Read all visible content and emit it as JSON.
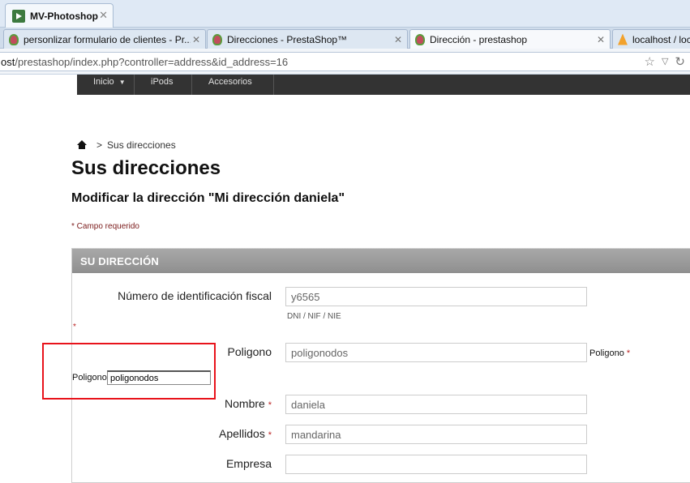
{
  "browser": {
    "app_tab": {
      "title": "MV-Photoshop",
      "close": "✕"
    },
    "tabs": [
      {
        "title": "personlizar formulario de clientes - Pr...",
        "close": "✕"
      },
      {
        "title": "Direcciones - PrestaShop™",
        "close": "✕"
      },
      {
        "title": "Dirección - prestashop",
        "close": "✕"
      },
      {
        "title": "localhost / loc"
      }
    ],
    "url": {
      "host": "ost",
      "path": "/prestashop/index.php?controller=address&id_address=16"
    },
    "icons": [
      "star-icon",
      "dropdown-icon",
      "reload-icon"
    ]
  },
  "nav": {
    "items": [
      {
        "label": "Inicio",
        "has_dropdown": true
      },
      {
        "label": "iPods"
      },
      {
        "label": "Accesorios"
      }
    ]
  },
  "breadcrumb": {
    "separator": ">",
    "current": "Sus direcciones"
  },
  "page": {
    "title": "Sus direcciones",
    "subtitle": "Modificar la dirección \"Mi dirección daniela\"",
    "required_note": "* Campo requerido"
  },
  "form": {
    "section_title": "SU DIRECCIÓN",
    "fields": [
      {
        "label": "Número de identificación fiscal",
        "value": "y6565",
        "hint": "DNI / NIF / NIE"
      },
      {
        "label": "Poligono",
        "value": "poligonodos",
        "side_label": "Poligono",
        "side_star": "*"
      },
      {
        "label": "Nombre",
        "star": "*",
        "value": "daniela"
      },
      {
        "label": "Apellidos",
        "star": "*",
        "value": "mandarina"
      },
      {
        "label": "Empresa",
        "value": ""
      }
    ],
    "stray_star": "*",
    "highlight": {
      "label": "Poligono",
      "value": "poligonodos"
    }
  },
  "colors": {
    "menu_bg": "#333333",
    "panel_header": "#999999",
    "highlight_border": "#e8131b",
    "required": "#b22222"
  }
}
